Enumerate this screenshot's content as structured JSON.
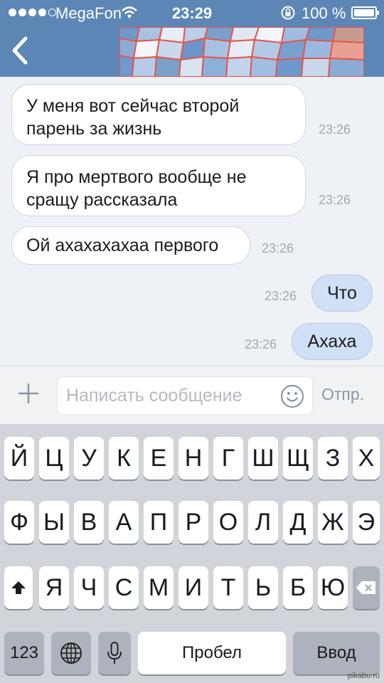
{
  "status_bar": {
    "carrier": "MegaFon",
    "time": "23:29",
    "battery": "100 %",
    "signal_bars": 4,
    "battery_level": 1.0
  },
  "messages": [
    {
      "direction": "in",
      "lines": [
        "У меня вот сейчас второй",
        "парень за жизнь"
      ],
      "time": "23:26"
    },
    {
      "direction": "in",
      "lines": [
        "Я про мертвого вообще не",
        "сращу рассказала"
      ],
      "time": "23:26"
    },
    {
      "direction": "in",
      "lines": [
        "Ой ахахахахаа первого"
      ],
      "time": "23:26"
    },
    {
      "direction": "out",
      "lines": [
        "Что"
      ],
      "time": "23:26"
    },
    {
      "direction": "out",
      "lines": [
        "Ахаха"
      ],
      "time": "23:26"
    }
  ],
  "compose": {
    "placeholder": "Написать сообщение",
    "send_label": "Отпр."
  },
  "keyboard": {
    "row1": [
      "Й",
      "Ц",
      "У",
      "К",
      "Е",
      "Н",
      "Г",
      "Ш",
      "Щ",
      "З",
      "Х"
    ],
    "row2": [
      "Ф",
      "Ы",
      "В",
      "А",
      "П",
      "Р",
      "О",
      "Л",
      "Д",
      "Ж",
      "Э"
    ],
    "row3": [
      "Я",
      "Ч",
      "С",
      "М",
      "И",
      "Т",
      "Ь",
      "Б",
      "Ю"
    ],
    "numbers_label": "123",
    "space_label": "Пробел",
    "return_label": "Ввод"
  },
  "watermark": "pikabu.ru",
  "colors": {
    "header": "#5c86b6",
    "incoming_bubble": "#ffffff",
    "outgoing_bubble": "#cfe0f7",
    "keyboard_bg": "#d1d5db"
  },
  "icons": [
    "back-chevron-icon",
    "wifi-icon",
    "rotation-lock-icon",
    "plus-icon",
    "smile-icon",
    "shift-icon",
    "globe-icon",
    "microphone-icon",
    "backspace-icon"
  ]
}
